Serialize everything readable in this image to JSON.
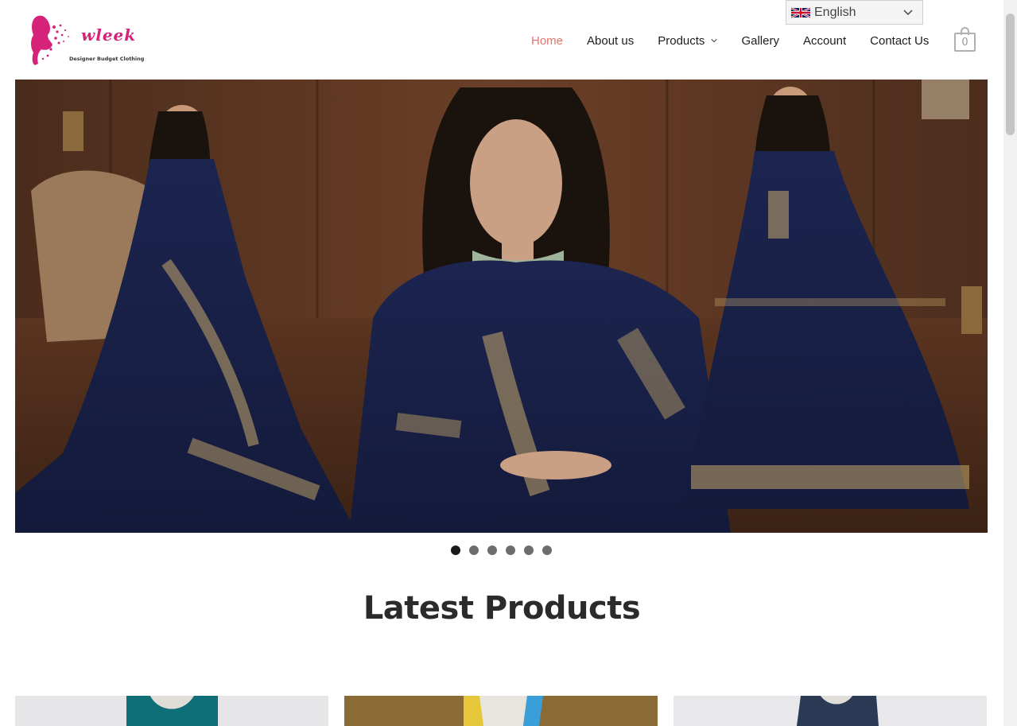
{
  "brand": {
    "logo_text": "wleek",
    "tagline": "Designer Budget Clothing",
    "accent": "#d6237a"
  },
  "language": {
    "label": "English",
    "flag_icon": "uk-flag-icon"
  },
  "nav": {
    "items": [
      {
        "label": "Home",
        "active": true
      },
      {
        "label": "About us"
      },
      {
        "label": "Products",
        "has_dropdown": true
      },
      {
        "label": "Gallery"
      },
      {
        "label": "Account"
      },
      {
        "label": "Contact Us"
      }
    ],
    "active_color": "#e5766d"
  },
  "cart": {
    "count": "0",
    "icon": "shopping-bag-icon"
  },
  "hero": {
    "slides": 6,
    "active_slide": 1
  },
  "latest": {
    "title": "Latest Products",
    "products": [
      {
        "color": "#0f6f79"
      },
      {
        "color": "#8a6a35"
      },
      {
        "color": "#2a3a55"
      }
    ]
  }
}
